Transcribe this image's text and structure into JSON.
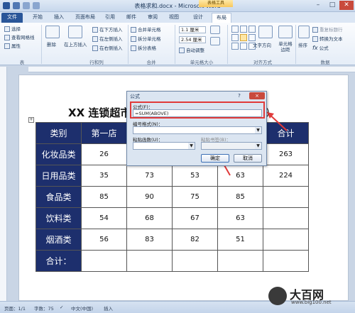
{
  "window": {
    "title": "表格求和.docx - Microsoft Word",
    "contextual_tab_group": "表格工具"
  },
  "tabs": [
    "文件",
    "开始",
    "插入",
    "页面布局",
    "引用",
    "邮件",
    "审阅",
    "视图",
    "设计",
    "布局"
  ],
  "ribbon": {
    "table_group": {
      "items": [
        "选择",
        "查看网格线",
        "属性"
      ],
      "label": "表"
    },
    "delete": "删除",
    "rows_cols": {
      "insert_above": "在上方插入",
      "insert_below": "在下方插入",
      "insert_left": "在左侧插入",
      "insert_right": "在右侧插入",
      "label": "行和列"
    },
    "merge": {
      "merge_cells": "合并单元格",
      "split_cells": "拆分单元格",
      "split_table": "拆分表格",
      "label": "合并"
    },
    "cell_size": {
      "height": "1.1 厘米",
      "width": "2.54 厘米",
      "autofit": "自动调整",
      "label": "单元格大小"
    },
    "alignment": {
      "text_direction": "文字方向",
      "cell_margins": "单元格边距",
      "label": "对齐方式"
    },
    "data": {
      "sort": "排序",
      "repeat_header": "重复标题行",
      "convert_text": "转换为文本",
      "formula": "公式",
      "label": "数据"
    }
  },
  "document": {
    "title_prefix": "XX 连锁超市",
    "title_suffix": "）",
    "table": {
      "header": [
        "类别",
        "第一店",
        "",
        "",
        "",
        "合计"
      ],
      "rows": [
        {
          "label": "化妆品类",
          "values": [
            "26",
            "",
            "",
            "",
            "263"
          ]
        },
        {
          "label": "日用品类",
          "values": [
            "35",
            "73",
            "53",
            "63",
            "224"
          ]
        },
        {
          "label": "食品类",
          "values": [
            "85",
            "90",
            "75",
            "85",
            ""
          ]
        },
        {
          "label": "饮料类",
          "values": [
            "54",
            "68",
            "67",
            "63",
            ""
          ]
        },
        {
          "label": "烟酒类",
          "values": [
            "56",
            "83",
            "82",
            "51",
            ""
          ]
        },
        {
          "label": "合计：",
          "values": [
            "",
            "",
            "",
            "",
            ""
          ]
        }
      ]
    }
  },
  "dialog": {
    "title": "公式",
    "help": "?",
    "close": "×",
    "formula_label": "公式(F)：",
    "formula_value": "=SUM(ABOVE)",
    "number_format_label": "编号格式(N)：",
    "paste_function_label": "粘贴函数(U)：",
    "paste_bookmark_label": "粘贴书签(B)：",
    "ok": "确定",
    "cancel": "取消"
  },
  "statusbar": {
    "page": "页面：1/1",
    "words": "字数：75",
    "language": "中文(中国)",
    "mode": "插入"
  },
  "watermark": {
    "brand": "大百网",
    "url": "www.big100.net"
  },
  "colors": {
    "table_header_bg": "#1d2f6d",
    "highlight": "#e03a3a",
    "file_tab": "#2a5699"
  }
}
